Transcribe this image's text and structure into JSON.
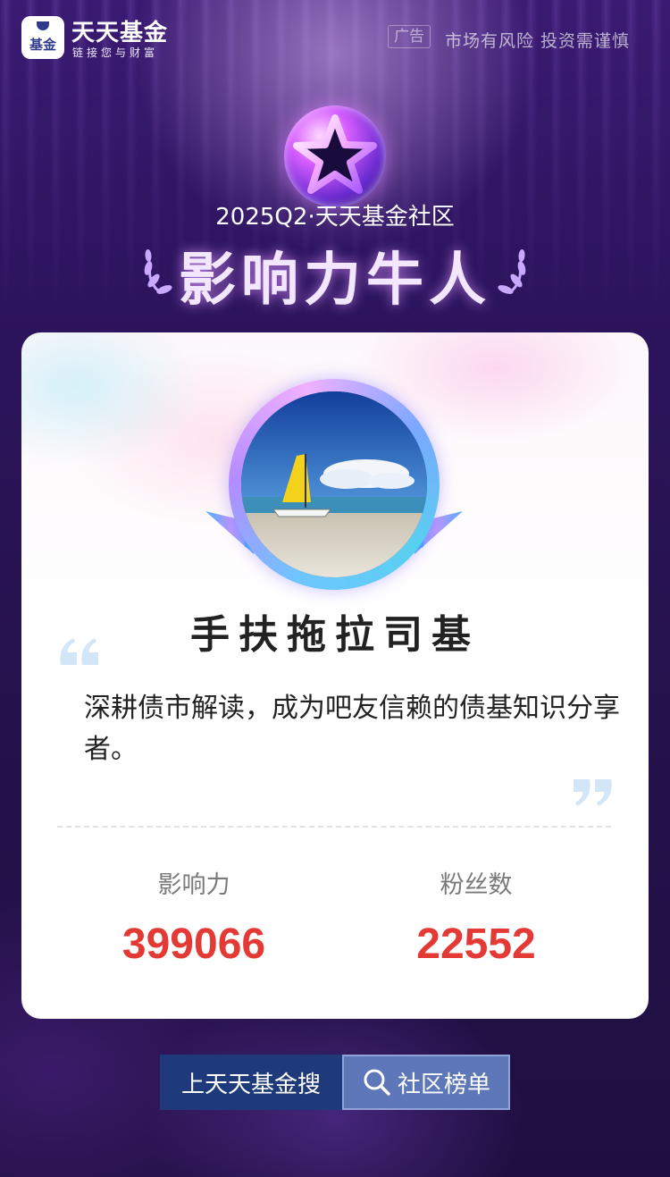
{
  "header": {
    "logo_text": "基金",
    "brand_name": "天天基金",
    "brand_slogan": "链接您与财富",
    "ad_tag": "广告",
    "risk_notice": "市场有风险 投资需谨慎"
  },
  "hero": {
    "season": "2025Q2·天天基金社区",
    "title": "影响力牛人"
  },
  "profile": {
    "username": "手扶拖拉司基",
    "bio": "深耕债市解读，成为吧友信赖的债基知识分享者。",
    "stats": [
      {
        "label": "影响力",
        "value": "399066"
      },
      {
        "label": "粉丝数",
        "value": "22552"
      }
    ]
  },
  "buttons": {
    "search_label": "上天天基金搜",
    "rank_label": "社区榜单"
  },
  "colors": {
    "accent_red": "#e43a35",
    "button_dark_blue": "#1f3a7a",
    "button_light_blue": "#5e77b8",
    "background_purple": "#2e1560"
  }
}
